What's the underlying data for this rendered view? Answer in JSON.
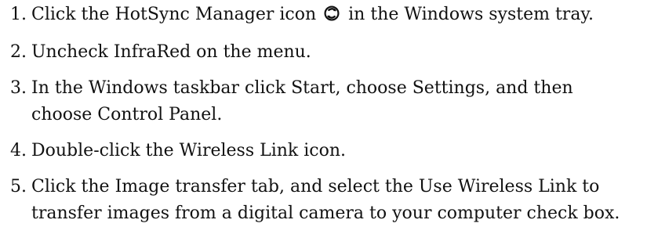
{
  "steps": [
    {
      "number": "1.",
      "before_icon": "Click the HotSync Manager icon",
      "icon": "hotsync-icon",
      "after_icon": "in the Windows system tray."
    },
    {
      "number": "2.",
      "text": "Uncheck InfraRed on the menu."
    },
    {
      "number": "3.",
      "text": "In the Windows taskbar click Start, choose Settings, and then choose Control Panel."
    },
    {
      "number": "4.",
      "text": "Double-click the Wireless Link icon."
    },
    {
      "number": "5.",
      "text": "Click the Image transfer tab, and select the Use Wireless Link to transfer images from a digital camera to your computer check box."
    }
  ]
}
